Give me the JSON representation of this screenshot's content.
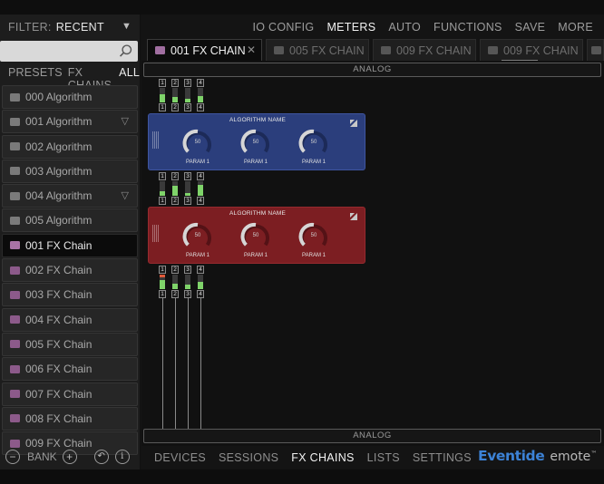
{
  "sidebar": {
    "filter_label": "FILTER:",
    "filter_value": "RECENT",
    "search_placeholder": "",
    "view_tabs": [
      "PRESETS",
      "FX CHAINS",
      "ALL"
    ],
    "items": [
      {
        "label": "000 Algorithm",
        "type": "algorithm",
        "expandable": false
      },
      {
        "label": "001 Algorithm",
        "type": "algorithm",
        "expandable": true
      },
      {
        "label": "002 Algorithm",
        "type": "algorithm",
        "expandable": false
      },
      {
        "label": "003 Algorithm",
        "type": "algorithm",
        "expandable": false
      },
      {
        "label": "004 Algorithm",
        "type": "algorithm",
        "expandable": true
      },
      {
        "label": "005 Algorithm",
        "type": "algorithm",
        "expandable": false
      },
      {
        "label": "001 FX Chain",
        "type": "chain",
        "selected": true
      },
      {
        "label": "002 FX Chain",
        "type": "chain"
      },
      {
        "label": "003 FX Chain",
        "type": "chain"
      },
      {
        "label": "004 FX Chain",
        "type": "chain"
      },
      {
        "label": "005 FX Chain",
        "type": "chain"
      },
      {
        "label": "006 FX Chain",
        "type": "chain"
      },
      {
        "label": "007 FX Chain",
        "type": "chain"
      },
      {
        "label": "008 FX Chain",
        "type": "chain"
      },
      {
        "label": "009 FX Chain",
        "type": "chain"
      }
    ],
    "bank_label": "BANK"
  },
  "top_menu": [
    "IO CONFIG",
    "METERS",
    "AUTO",
    "FUNCTIONS",
    "SAVE",
    "MORE"
  ],
  "top_menu_active": "METERS",
  "chain_tabs": [
    "001 FX CHAIN",
    "005 FX CHAIN",
    "009 FX CHAIN",
    "009 FX CHAIN"
  ],
  "io": {
    "input_label": "ANALOG",
    "output_label": "ANALOG"
  },
  "meters": {
    "channels": [
      "1",
      "2",
      "3",
      "4"
    ],
    "stage1_levels": [
      0.55,
      0.35,
      0.25,
      0.45
    ],
    "stage2_levels": [
      0.3,
      0.7,
      0.2,
      0.75
    ],
    "stage3_levels": [
      0.6,
      0.35,
      0.3,
      0.5
    ]
  },
  "modules": [
    {
      "title": "ALGORITHM NAME",
      "color": "#2b3e7c",
      "params": [
        {
          "label": "PARAM 1",
          "value": "50"
        },
        {
          "label": "PARAM 1",
          "value": "50"
        },
        {
          "label": "PARAM 1",
          "value": "50"
        }
      ]
    },
    {
      "title": "ALGORITHM NAME",
      "color": "#7c1e22",
      "params": [
        {
          "label": "PARAM 1",
          "value": "50"
        },
        {
          "label": "PARAM 1",
          "value": "50"
        },
        {
          "label": "PARAM 1",
          "value": "50"
        }
      ]
    }
  ],
  "bottom_nav": [
    "DEVICES",
    "SESSIONS",
    "FX CHAINS",
    "LISTS",
    "SETTINGS"
  ],
  "bottom_nav_active": "FX CHAINS",
  "logo": {
    "brand": "Eventide",
    "product": "emote",
    "trademark": "™"
  }
}
